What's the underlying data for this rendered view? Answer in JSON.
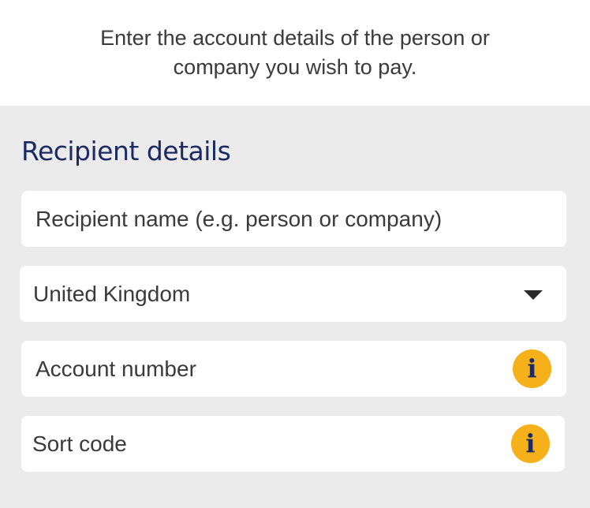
{
  "intro": {
    "text": "Enter the account details of the person or company you wish to pay."
  },
  "recipient_form": {
    "title": "Recipient details",
    "name_field": {
      "placeholder": "Recipient name (e.g. person or company)"
    },
    "country_select": {
      "selected_value": "United Kingdom",
      "icon": "chevron-down-icon"
    },
    "account_number_field": {
      "placeholder": "Account number",
      "info_icon": "info-icon"
    },
    "sort_code_field": {
      "placeholder": "Sort code",
      "info_icon": "info-icon"
    }
  },
  "colors": {
    "title": "#1b2a63",
    "info_badge": "#f6b019",
    "background": "#ebebeb"
  }
}
